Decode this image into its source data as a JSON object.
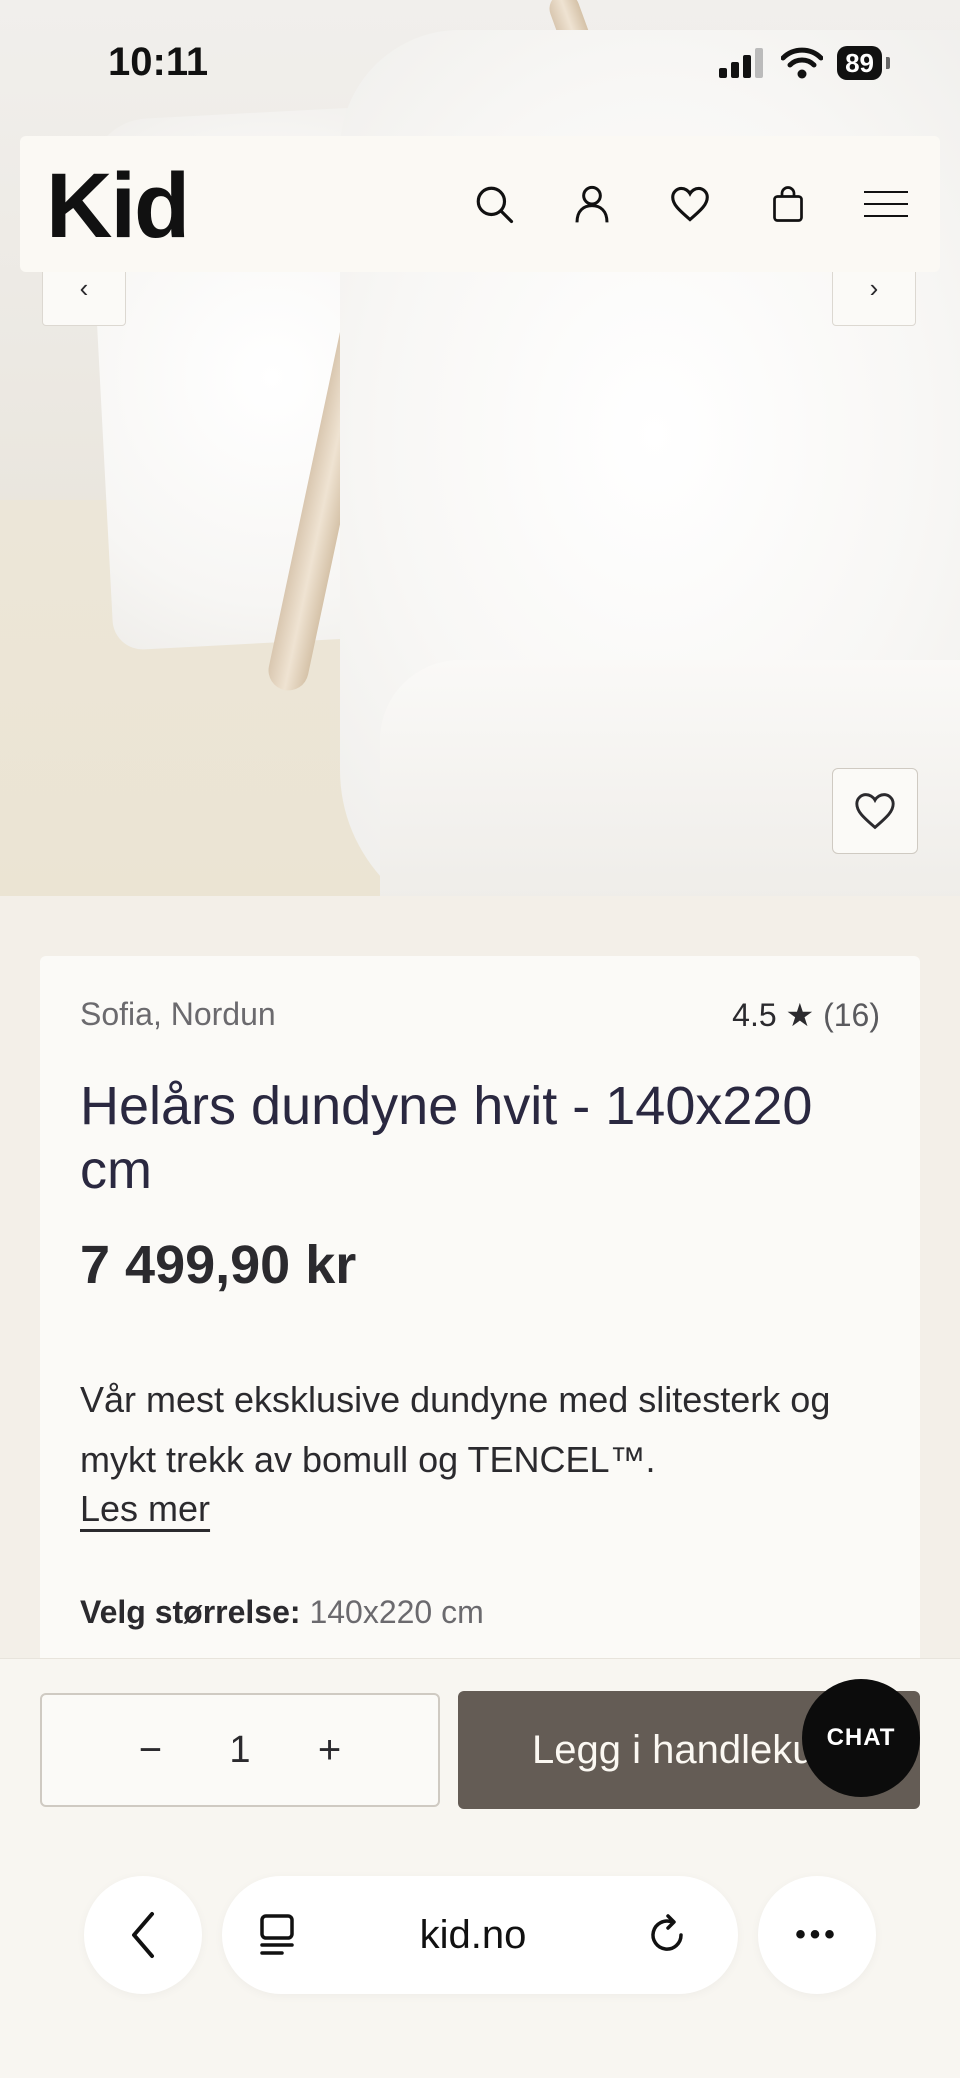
{
  "status_bar": {
    "time": "10:11",
    "battery": "89"
  },
  "header": {
    "logo": "Kid"
  },
  "hero": {
    "prev": "‹",
    "next": "›"
  },
  "product": {
    "brand": "Sofia, Nordun",
    "rating": "4.5",
    "rating_star": "★",
    "review_count": "(16)",
    "title": "Helårs dundyne hvit - 140x220 cm",
    "price": "7 499,90 kr",
    "description": "Vår mest eksklusive dundyne med slitesterk og mykt trekk av bomull og TENCEL™.",
    "read_more": "Les mer",
    "size_label": "Velg størrelse:",
    "size_value": "140x220 cm"
  },
  "cart_bar": {
    "minus": "−",
    "quantity": "1",
    "plus": "+",
    "add_label": "Legg i handlekurv",
    "chat_label": "CHAT"
  },
  "browser": {
    "url": "kid.no",
    "back": "‹",
    "more": "•••"
  },
  "colors": {
    "add_button": "#645c55",
    "chat": "#0c0c0c",
    "background": "#f3efe8"
  }
}
